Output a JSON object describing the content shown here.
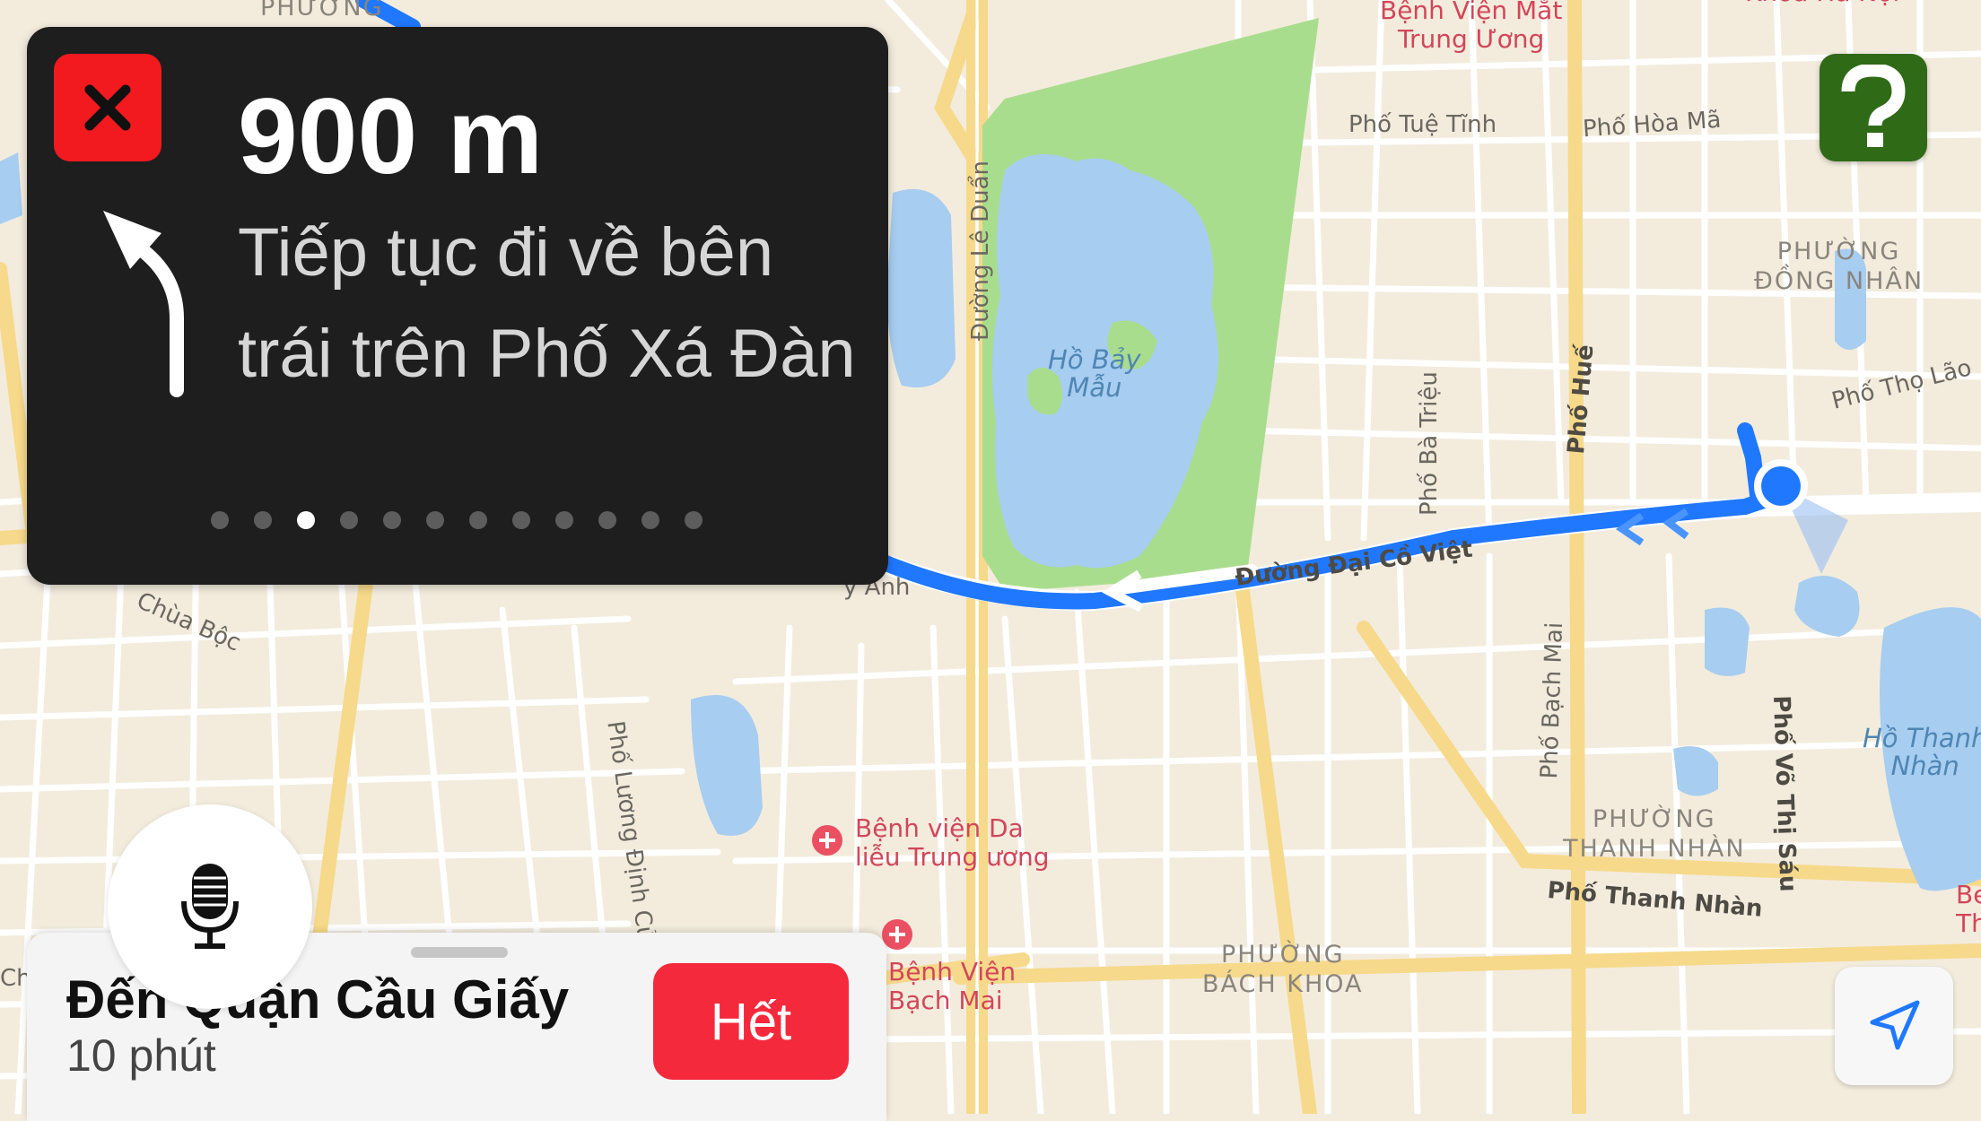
{
  "colors": {
    "map_background": "#f3ecdd",
    "park": "#a9dd8e",
    "water": "#a7cdf0",
    "route": "#1f78ff",
    "close_button": "#f2191f",
    "help_button": "#2f6a17",
    "end_button": "#f5293c"
  },
  "navigation": {
    "close_icon": "close-icon",
    "turn_icon": "turn-slight-left-arrow-icon",
    "distance": "900 m",
    "instruction": "Tiếp tục đi về bên trái trên Phố Xá Đàn",
    "steps_total": 12,
    "current_step": 3
  },
  "help": {
    "icon": "question-mark-icon"
  },
  "bottom_card": {
    "destination": "Đến Quận Cầu Giấy",
    "eta": "10 phút",
    "end_label": "Hết"
  },
  "mic": {
    "icon": "microphone-icon"
  },
  "locate": {
    "icon": "location-arrow-icon"
  },
  "map_labels": {
    "phuong_top": "PHƯỜNG",
    "benh_vien_mat": "Bệnh Viện Mắt\nTrung Ương",
    "khoa_ha_noi": "Khoa Hà Nội",
    "pho_tue_tinh": "Phố Tuệ Tĩnh",
    "pho_hoa_ma": "Phố Hòa Mã",
    "duong_le_duan": "Đường Lê Duẩn",
    "ho_bay_mau": "Hồ Bảy\nMẫu",
    "phuong_dong_nhan": "PHƯỜNG\nĐỒNG NHÂN",
    "pho_tho_lao": "Phố Thọ Lão",
    "pho_ba_trieu": "Phố Bà Triệu",
    "pho_hue": "Phố Huế",
    "duong_dai_co_viet": "Đường Đại Cồ Việt",
    "chua_boc": "Chùa Bộc",
    "pho_bach_mai": "Phố Bạch Mai",
    "pho_vo_thi_sau": "Phố Võ Thị Sáu",
    "ho_thanh_nhan": "Hồ Thanh\nNhàn",
    "phuong_thanh_nhan": "PHƯỜNG\nTHANH NHÀN",
    "pho_thanh_nhan": "Phố Thanh Nhàn",
    "pho_luong_dinh_cua": "Phố Lương Định Của",
    "benh_vien_da_lieu": "Bệnh viện Da\nliễu Trung ương",
    "benh_vien_bach_mai": "Bệnh Viện\nBạch Mai",
    "phuong_bach_khoa": "PHƯỜNG\nBÁCH KHOA",
    "anh_fragment": "y Anh",
    "ch_fragment": "Ch",
    "right_edge_fragment": "Be\nTh"
  }
}
